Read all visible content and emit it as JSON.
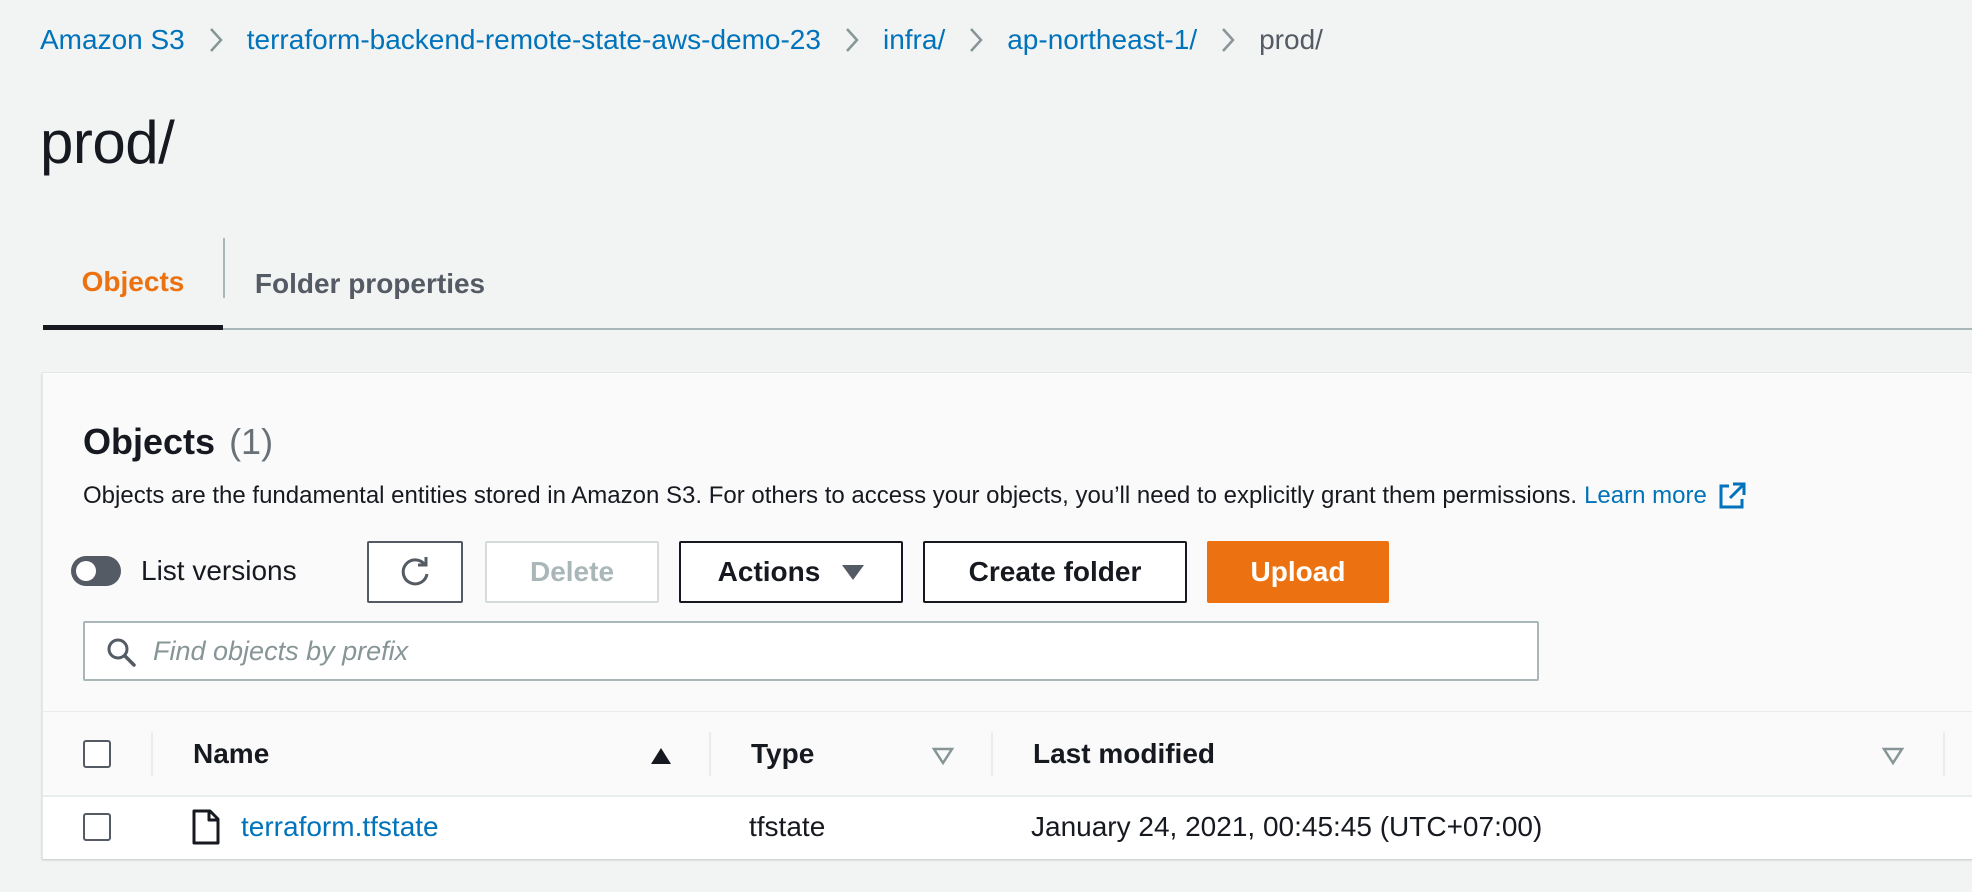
{
  "breadcrumb": {
    "items": [
      {
        "label": "Amazon S3"
      },
      {
        "label": "terraform-backend-remote-state-aws-demo-23"
      },
      {
        "label": "infra/"
      },
      {
        "label": "ap-northeast-1/"
      },
      {
        "label": "prod/"
      }
    ]
  },
  "page": {
    "title": "prod/"
  },
  "tabs": [
    {
      "label": "Objects",
      "active": true
    },
    {
      "label": "Folder properties",
      "active": false
    }
  ],
  "objects_panel": {
    "heading": "Objects",
    "count": "(1)",
    "description": "Objects are the fundamental entities stored in Amazon S3. For others to access your objects, you’ll need to explicitly grant them permissions.",
    "learn_more": "Learn more",
    "toolbar": {
      "list_versions_label": "List versions",
      "delete_label": "Delete",
      "actions_label": "Actions",
      "create_folder_label": "Create folder",
      "upload_label": "Upload"
    },
    "search": {
      "placeholder": "Find objects by prefix",
      "value": ""
    },
    "table": {
      "columns": [
        "Name",
        "Type",
        "Last modified"
      ],
      "rows": [
        {
          "name": "terraform.tfstate",
          "type": "tfstate",
          "last_modified": "January 24, 2021, 00:45:45 (UTC+07:00)"
        }
      ]
    }
  },
  "colors": {
    "accent": "#ec7211",
    "link": "#0073bb",
    "text": "#16191f",
    "muted": "#545b64",
    "background": "#f2f3f3"
  },
  "icons": [
    "chevron-right-icon",
    "external-link-icon",
    "refresh-icon",
    "caret-down-icon",
    "search-icon",
    "sort-ascending-icon",
    "sort-descending-icon",
    "file-icon"
  ]
}
